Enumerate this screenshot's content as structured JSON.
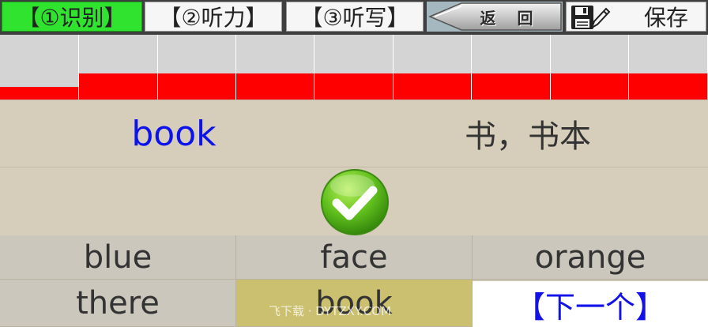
{
  "tabs": [
    {
      "label": "【①识别】",
      "active": true
    },
    {
      "label": "【②听力】",
      "active": false
    },
    {
      "label": "【③听写】",
      "active": false
    }
  ],
  "back_button": {
    "label": "返 回"
  },
  "save_button": {
    "label": "保存"
  },
  "progress": [
    {
      "fill_fraction": 0.2
    },
    {
      "fill_fraction": 0.4
    },
    {
      "fill_fraction": 0.4
    },
    {
      "fill_fraction": 0.4
    },
    {
      "fill_fraction": 0.4
    },
    {
      "fill_fraction": 0.4
    },
    {
      "fill_fraction": 0.4
    },
    {
      "fill_fraction": 0.4
    },
    {
      "fill_fraction": 0.4
    }
  ],
  "word": {
    "english": "book",
    "chinese": "书，书本"
  },
  "feedback": {
    "icon": "check-icon",
    "correct": true
  },
  "options": [
    {
      "label": "blue",
      "selected": false
    },
    {
      "label": "face",
      "selected": false
    },
    {
      "label": "orange",
      "selected": false
    },
    {
      "label": "there",
      "selected": false
    },
    {
      "label": "book",
      "selected": true
    }
  ],
  "next_button": {
    "label": "【下一个】"
  },
  "watermark": {
    "text": "飞下载 · DYTZXY.COM"
  },
  "colors": {
    "active_tab": "#2fe32f",
    "progress_fill": "#ff0000",
    "english_word": "#0b12ee",
    "selected_option": "#cbc070",
    "next_button_text": "#1212e8",
    "check_green": "#4caf1a"
  }
}
